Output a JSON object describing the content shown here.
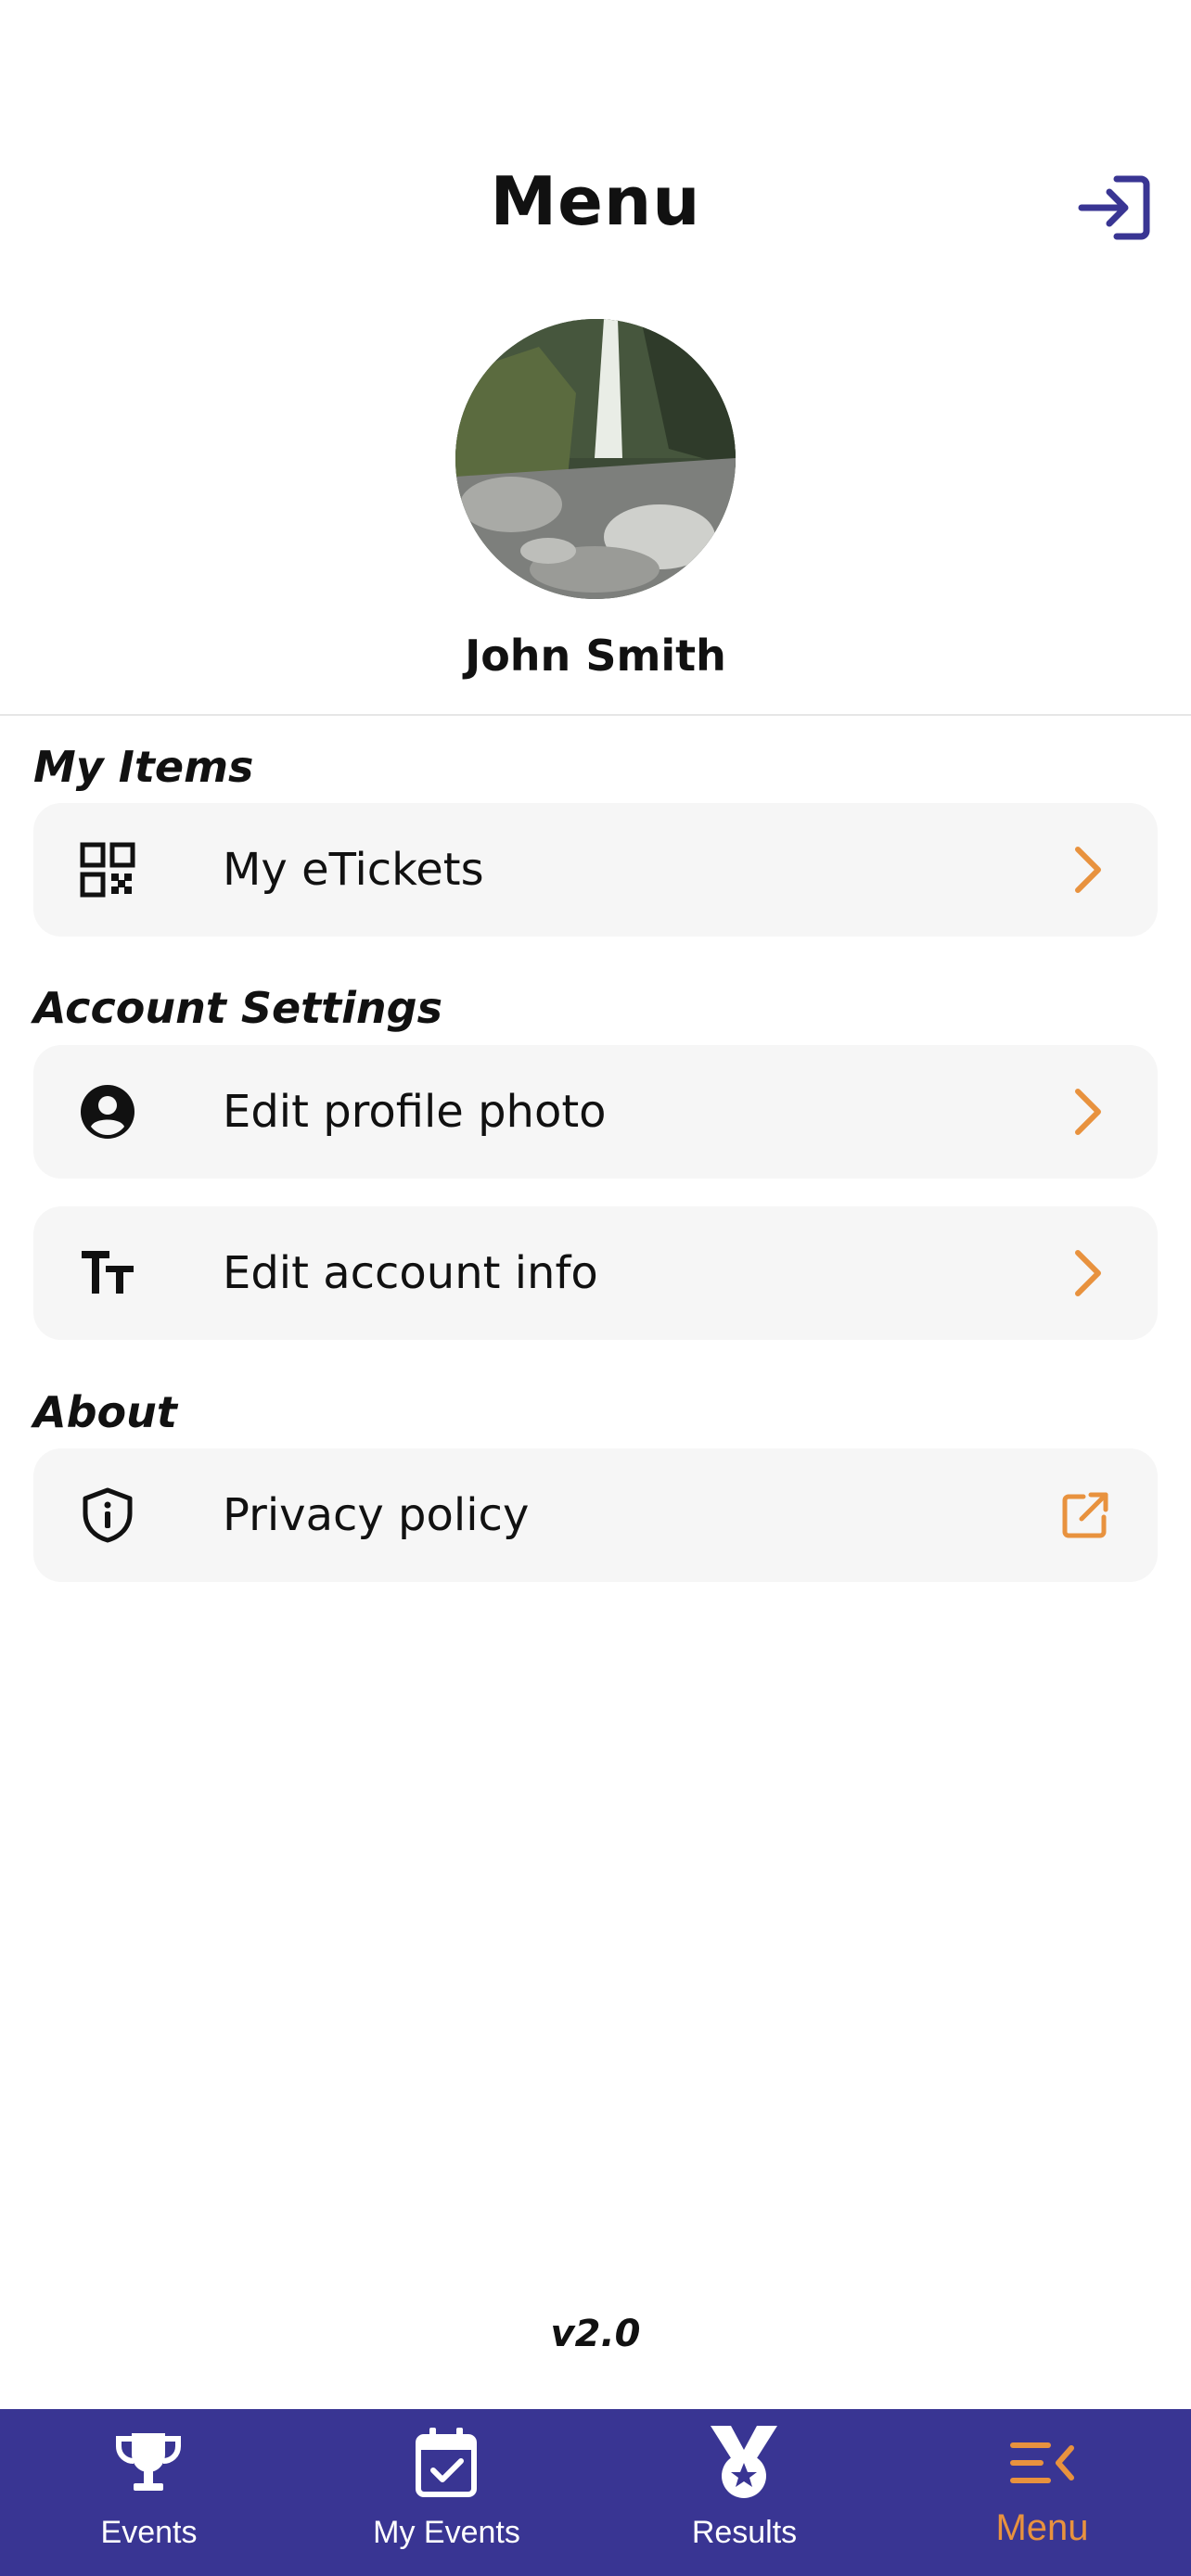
{
  "header": {
    "title": "Menu",
    "login_icon": "login-arrow-icon",
    "username": "John Smith"
  },
  "sections": [
    {
      "title": "My Items",
      "items": [
        {
          "label": "My eTickets",
          "icon": "qr-code-icon",
          "trail_icon": "chevron-right-icon"
        }
      ]
    },
    {
      "title": "Account Settings",
      "items": [
        {
          "label": "Edit profile photo",
          "icon": "account-circle-icon",
          "trail_icon": "chevron-right-icon"
        },
        {
          "label": "Edit account info",
          "icon": "text-size-icon",
          "trail_icon": "chevron-right-icon"
        }
      ]
    },
    {
      "title": "About",
      "items": [
        {
          "label": "Privacy policy",
          "icon": "shield-info-icon",
          "trail_icon": "external-link-icon"
        }
      ]
    }
  ],
  "version": "v2.0",
  "tabs": [
    {
      "label": "Events",
      "icon": "trophy-icon",
      "active": false
    },
    {
      "label": "My Events",
      "icon": "calendar-check-icon",
      "active": false
    },
    {
      "label": "Results",
      "icon": "medal-icon",
      "active": false
    },
    {
      "label": "Menu",
      "icon": "menu-open-icon",
      "active": true
    }
  ],
  "colors": {
    "primary": "#393593",
    "accent": "#e8923e",
    "row_background": "#f6f6f6",
    "text": "#111111"
  }
}
